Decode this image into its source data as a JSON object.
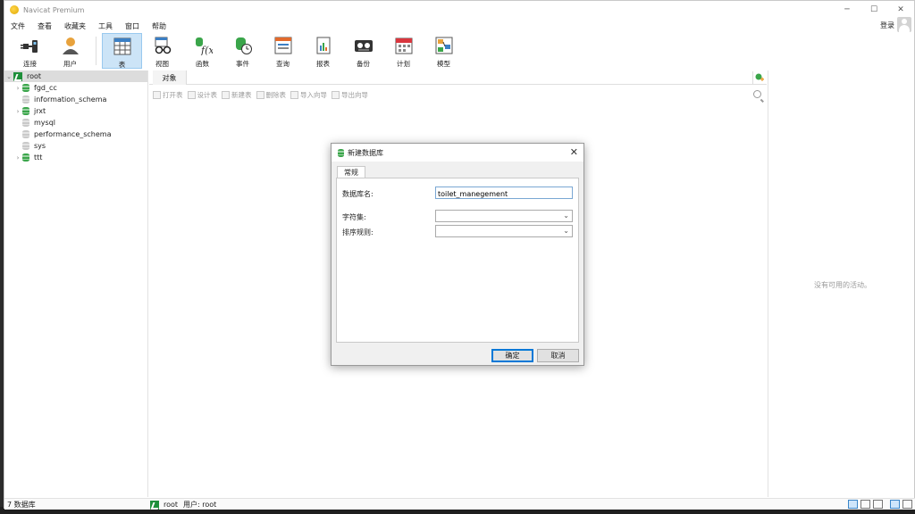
{
  "app": {
    "title": "Navicat Premium"
  },
  "window_controls": {
    "minimize": "─",
    "maximize": "☐",
    "close": "✕"
  },
  "menu": [
    "文件",
    "查看",
    "收藏夹",
    "工具",
    "窗口",
    "帮助"
  ],
  "account": {
    "login_label": "登录"
  },
  "toolbar": {
    "left": [
      {
        "label": "连接",
        "icon": "plug-icon"
      },
      {
        "label": "用户",
        "icon": "user-icon"
      }
    ],
    "main": [
      {
        "label": "表",
        "icon": "table-icon",
        "active": true
      },
      {
        "label": "视图",
        "icon": "view-glasses-icon"
      },
      {
        "label": "函数",
        "icon": "function-icon"
      },
      {
        "label": "事件",
        "icon": "event-clock-icon"
      },
      {
        "label": "查询",
        "icon": "query-icon"
      },
      {
        "label": "报表",
        "icon": "report-icon"
      },
      {
        "label": "备份",
        "icon": "backup-icon"
      },
      {
        "label": "计划",
        "icon": "calendar-icon"
      },
      {
        "label": "模型",
        "icon": "model-icon"
      }
    ]
  },
  "tree": {
    "connection": "root",
    "databases": [
      {
        "name": "fgd_cc",
        "expandable": true,
        "state": "open"
      },
      {
        "name": "information_schema",
        "expandable": false,
        "state": "closed"
      },
      {
        "name": "jrxt",
        "expandable": true,
        "state": "open"
      },
      {
        "name": "mysql",
        "expandable": false,
        "state": "closed"
      },
      {
        "name": "performance_schema",
        "expandable": false,
        "state": "closed"
      },
      {
        "name": "sys",
        "expandable": false,
        "state": "closed"
      },
      {
        "name": "ttt",
        "expandable": true,
        "state": "open"
      }
    ]
  },
  "center": {
    "tab_label": "对象",
    "actions": [
      "打开表",
      "设计表",
      "新建表",
      "删除表",
      "导入向导",
      "导出向导"
    ]
  },
  "right_pane": {
    "empty_text": "没有可用的活动。"
  },
  "status": {
    "db_count": "7 数据库",
    "connection": "root",
    "user": "用户: root"
  },
  "dialog": {
    "title": "新建数据库",
    "tab": "常规",
    "fields": {
      "name_label": "数据库名:",
      "name_value": "toilet_manegement",
      "charset_label": "字符集:",
      "charset_value": "",
      "collation_label": "排序规则:",
      "collation_value": ""
    },
    "ok_label": "确定",
    "cancel_label": "取消"
  },
  "colors": {
    "accent": "#0078d7",
    "active_toolbar": "#cce4f7",
    "db_green": "#3aa54a"
  }
}
